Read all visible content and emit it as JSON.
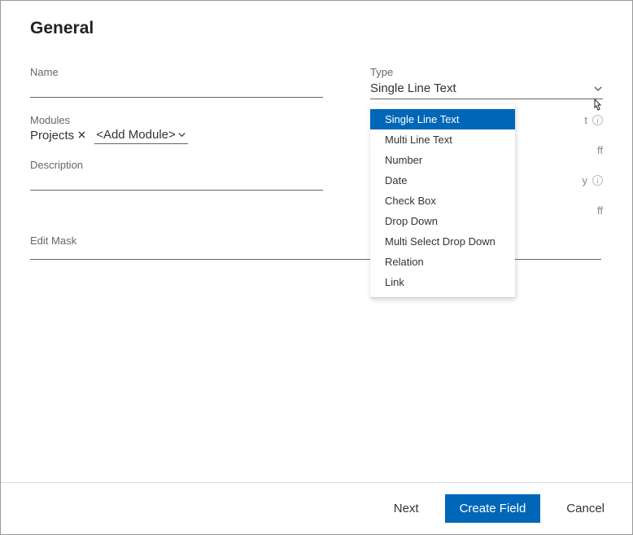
{
  "section_title": "General",
  "name": {
    "label": "Name",
    "value": ""
  },
  "type": {
    "label": "Type",
    "selected": "Single Line Text",
    "options": [
      "Single Line Text",
      "Multi Line Text",
      "Number",
      "Date",
      "Check Box",
      "Drop Down",
      "Multi Select Drop Down",
      "Relation",
      "Link"
    ]
  },
  "modules": {
    "label": "Modules",
    "tags": [
      "Projects"
    ],
    "add_label": "<Add Module>"
  },
  "toggles": {
    "important_suffix": "t",
    "important_state": "ff",
    "readonly_suffix": "y",
    "readonly_state": "ff"
  },
  "description": {
    "label": "Description",
    "value": ""
  },
  "edit_mask": {
    "label": "Edit Mask"
  },
  "footer": {
    "next": "Next",
    "create": "Create Field",
    "cancel": "Cancel"
  }
}
